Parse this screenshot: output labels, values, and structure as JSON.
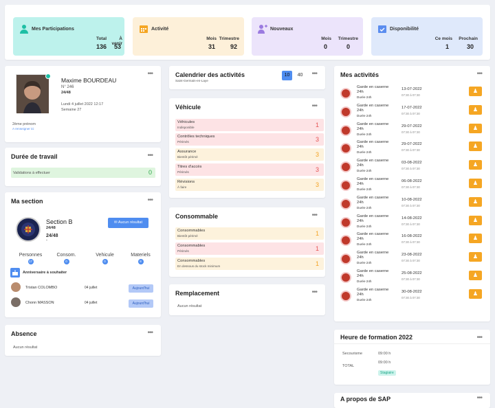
{
  "stats": [
    {
      "title": "Mes Participations",
      "labels": [
        "Total",
        "À venir"
      ],
      "values": [
        "136",
        "53"
      ],
      "color": "#bdf2ec",
      "icon": "user-icon"
    },
    {
      "title": "Activité",
      "labels": [
        "Mois",
        "Trimestre"
      ],
      "values": [
        "31",
        "92"
      ],
      "color": "#fdf0d9",
      "icon": "calendar-icon"
    },
    {
      "title": "Nouveaux",
      "labels": [
        "Mois",
        "Trimestre"
      ],
      "values": [
        "0",
        "0"
      ],
      "color": "#ece4fb",
      "icon": "user-add-icon"
    },
    {
      "title": "Disponibilité",
      "labels": [
        "Ce mois",
        "Prochain"
      ],
      "values": [
        "1",
        "30"
      ],
      "color": "#dfe9fb",
      "icon": "calendar-check-icon"
    }
  ],
  "profile": {
    "name": "Maxime BOURDEAU",
    "number": "N° 246",
    "hours": "24/48",
    "date": "Lundi 4 juillet 2022 12:17",
    "week": "Semaine 27",
    "second_name_label": "2ème prénom",
    "second_name_value": "A renseigner ici"
  },
  "duree": {
    "title": "Durée de travail",
    "row_label": "Validations à effectuer",
    "row_value": "0"
  },
  "section": {
    "title": "Ma section",
    "name": "Section B",
    "hours": "24/48",
    "dash": "-",
    "button": "Aucun résultat",
    "stats": [
      {
        "label": "Personnes",
        "value": "17"
      },
      {
        "label": "Consom.",
        "value": "0"
      },
      {
        "label": "Vehicule",
        "value": "0"
      },
      {
        "label": "Materiels",
        "value": "8"
      }
    ],
    "birthday_title": "Anniversaire à souhaiter",
    "birthdays": [
      {
        "name": "Tristan COLOMBO",
        "date": "04 juillet",
        "badge": "Aujourd'hui"
      },
      {
        "name": "Chonn MASSON",
        "date": "04 juillet",
        "badge": "Aujourd'hui"
      }
    ]
  },
  "absence": {
    "title": "Absence",
    "empty": "Aucun résultat"
  },
  "calendar": {
    "title": "Calendrier des activités",
    "subtitle": "Saint-Germain-en-Laye",
    "count_a": "10",
    "count_b": "40"
  },
  "vehicule": {
    "title": "Véhicule",
    "rows": [
      {
        "t": "Véhicules",
        "s": "Indisponible",
        "n": "1",
        "c": "pink"
      },
      {
        "t": "Contrôles techniques",
        "s": "Périmés",
        "n": "3",
        "c": "pink"
      },
      {
        "t": "Assurance",
        "s": "Bientôt périmé",
        "n": "3",
        "c": "yel"
      },
      {
        "t": "Titres d'accès",
        "s": "Périmés",
        "n": "3",
        "c": "pink"
      },
      {
        "t": "Révisions",
        "s": "À faire",
        "n": "3",
        "c": "yel"
      }
    ]
  },
  "consommable": {
    "title": "Consommable",
    "rows": [
      {
        "t": "Consommables",
        "s": "Bientôt périmé",
        "n": "1",
        "c": "yel"
      },
      {
        "t": "Consommables",
        "s": "Périmés",
        "n": "1",
        "c": "pink"
      },
      {
        "t": "Consommables",
        "s": "En dessous du stock minimum",
        "n": "1",
        "c": "yel"
      }
    ]
  },
  "remplacement": {
    "title": "Remplacement",
    "empty": "Aucun résultat"
  },
  "activites": {
    "title": "Mes activités",
    "items": [
      {
        "t1": "Garde en caserne",
        "t2": "24h",
        "t3": "Durée 24h",
        "d": "13-07-2022",
        "h": "07:30 à 07:30"
      },
      {
        "t1": "Garde en caserne",
        "t2": "24h",
        "t3": "Durée 24h",
        "d": "17-07-2022",
        "h": "07:30 à 07:30"
      },
      {
        "t1": "Garde en caserne",
        "t2": "24h",
        "t3": "Durée 24h",
        "d": "29-07-2022",
        "h": "07:30 à 07:30"
      },
      {
        "t1": "Garde en caserne",
        "t2": "24h",
        "t3": "Durée 24h",
        "d": "29-07-2022",
        "h": "07:30 à 07:30"
      },
      {
        "t1": "Garde en caserne",
        "t2": "24h",
        "t3": "Durée 24h",
        "d": "03-08-2022",
        "h": "07:30 à 07:30"
      },
      {
        "t1": "Garde en caserne",
        "t2": "24h",
        "t3": "Durée 24h",
        "d": "06-08-2022",
        "h": "07:30 à 07:30"
      },
      {
        "t1": "Garde en caserne",
        "t2": "24h",
        "t3": "Durée 24h",
        "d": "10-08-2022",
        "h": "07:30 à 07:30"
      },
      {
        "t1": "Garde en caserne",
        "t2": "24h",
        "t3": "Durée 24h",
        "d": "14-08-2022",
        "h": "07:30 à 07:30"
      },
      {
        "t1": "Garde en caserne",
        "t2": "24h",
        "t3": "Durée 24h",
        "d": "16-08-2022",
        "h": "07:30 à 07:30"
      },
      {
        "t1": "Garde en caserne",
        "t2": "24h",
        "t3": "Durée 24h",
        "d": "23-08-2022",
        "h": "07:30 à 07:30"
      },
      {
        "t1": "Garde en caserne",
        "t2": "24h",
        "t3": "Durée 24h",
        "d": "25-08-2022",
        "h": "07:30 à 07:30"
      },
      {
        "t1": "Garde en caserne",
        "t2": "24h",
        "t3": "Durée 24h",
        "d": "30-08-2022",
        "h": "07:30 à 07:30"
      }
    ]
  },
  "formation": {
    "title": "Heure de formation 2022",
    "r1_label": "Secourisme",
    "r1_value": "09:00 h",
    "r2_label": "TOTAL",
    "r2_value": "09:00 h",
    "badge": "Stagiaire"
  },
  "apropos": {
    "title": "A propos de SAP"
  },
  "menu": "•••"
}
